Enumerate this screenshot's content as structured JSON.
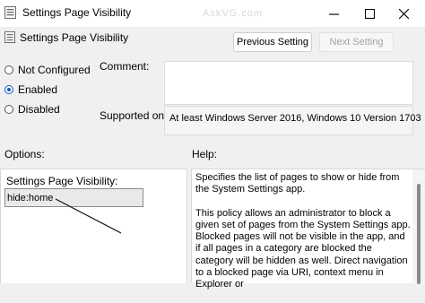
{
  "window": {
    "title": "Settings Page Visibility",
    "watermark": "AskVG.com"
  },
  "header": {
    "title": "Settings Page Visibility",
    "prev_label": "Previous Setting",
    "next_label": "Next Setting"
  },
  "state": {
    "options": [
      "Not Configured",
      "Enabled",
      "Disabled"
    ],
    "selected": "Enabled"
  },
  "comment": {
    "label": "Comment:",
    "value": ""
  },
  "supported": {
    "label": "Supported on:",
    "value": "At least Windows Server 2016, Windows 10 Version 1703"
  },
  "options_section": {
    "label": "Options:",
    "field_label": "Settings Page Visibility:",
    "field_value": "hide:home"
  },
  "help_section": {
    "label": "Help:",
    "paragraphs": [
      "Specifies the list of pages to show or hide from the System Settings app.",
      "This policy allows an administrator to block a given set of pages from the System Settings app. Blocked pages will not be visible in the app, and if all pages in a category are blocked the category will be hidden as well. Direct navigation to a blocked page via URI, context menu in Explorer or"
    ]
  },
  "icons": {
    "title": "policy-icon",
    "minimize": "minimize-icon",
    "maximize": "maximize-icon",
    "close": "close-icon"
  },
  "colors": {
    "accent": "#0c5fc1",
    "background": "#f0f0f0"
  }
}
